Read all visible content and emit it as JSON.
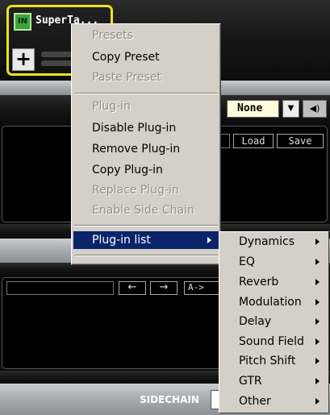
{
  "slot": {
    "in_label": "IN",
    "name": "SuperTa...",
    "add_label": "+"
  },
  "plugin_select": {
    "value": "None"
  },
  "preset_buttons": {
    "load": "Load",
    "save": "Save"
  },
  "nav": {
    "left": "←",
    "right": "→",
    "ab": "A->"
  },
  "sidechain_label": "SIDECHAIN",
  "context_menu": {
    "items": [
      {
        "label": "Presets",
        "enabled": false
      },
      {
        "label": "Copy Preset",
        "enabled": true
      },
      {
        "label": "Paste Preset",
        "enabled": false
      },
      {
        "label": "Plug-in",
        "enabled": false
      },
      {
        "label": "Disable Plug-in",
        "enabled": true
      },
      {
        "label": "Remove Plug-in",
        "enabled": true
      },
      {
        "label": "Copy Plug-in",
        "enabled": true
      },
      {
        "label": "Replace Plug-in",
        "enabled": false
      },
      {
        "label": "Enable Side Chain",
        "enabled": false
      },
      {
        "label": "Plug-in list",
        "enabled": true,
        "highlighted": true,
        "has_submenu": true
      }
    ]
  },
  "submenu": {
    "items": [
      "Dynamics",
      "EQ",
      "Reverb",
      "Modulation",
      "Delay",
      "Sound Field",
      "Pitch Shift",
      "GTR",
      "Other"
    ]
  },
  "colors": {
    "highlight": "#0a246a",
    "menu_bg": "#d4d0c8",
    "slot_border": "#f0e21a",
    "in_button": "#3ca43c"
  }
}
